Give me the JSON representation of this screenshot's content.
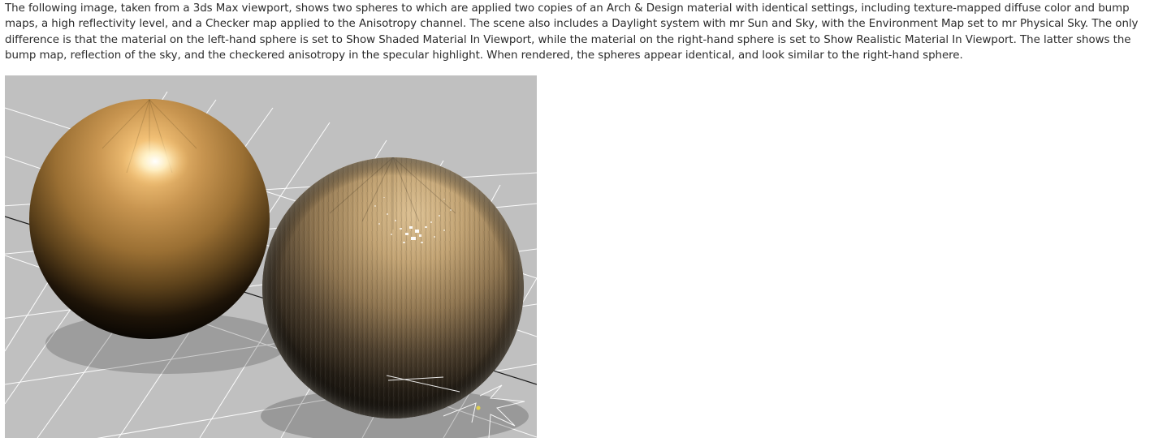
{
  "description": "The following image, taken from a 3ds Max viewport, shows two spheres to which are applied two copies of an Arch & Design material with identical settings, including texture-mapped diffuse color and bump maps, a high reflectivity level, and a Checker map applied to the Anisotropy channel. The scene also includes a Daylight system with mr Sun and Sky, with the Environment Map set to mr Physical Sky. The only difference is that the material on the left-hand sphere is set to Show Shaded Material In Viewport, while the material on the right-hand sphere is set to Show Realistic Material In Viewport. The latter shows the bump map, reflection of the sky, and the checkered anisotropy in the specular highlight. When rendered, the spheres appear identical, and look similar to the right-hand sphere.",
  "viewport": {
    "background_color": "#c0c0c0",
    "grid_color": "#ffffff",
    "grid_dark_color": "#1a1a1a",
    "left_sphere_color": "#b98a45",
    "right_sphere_color": "#a58a62"
  }
}
